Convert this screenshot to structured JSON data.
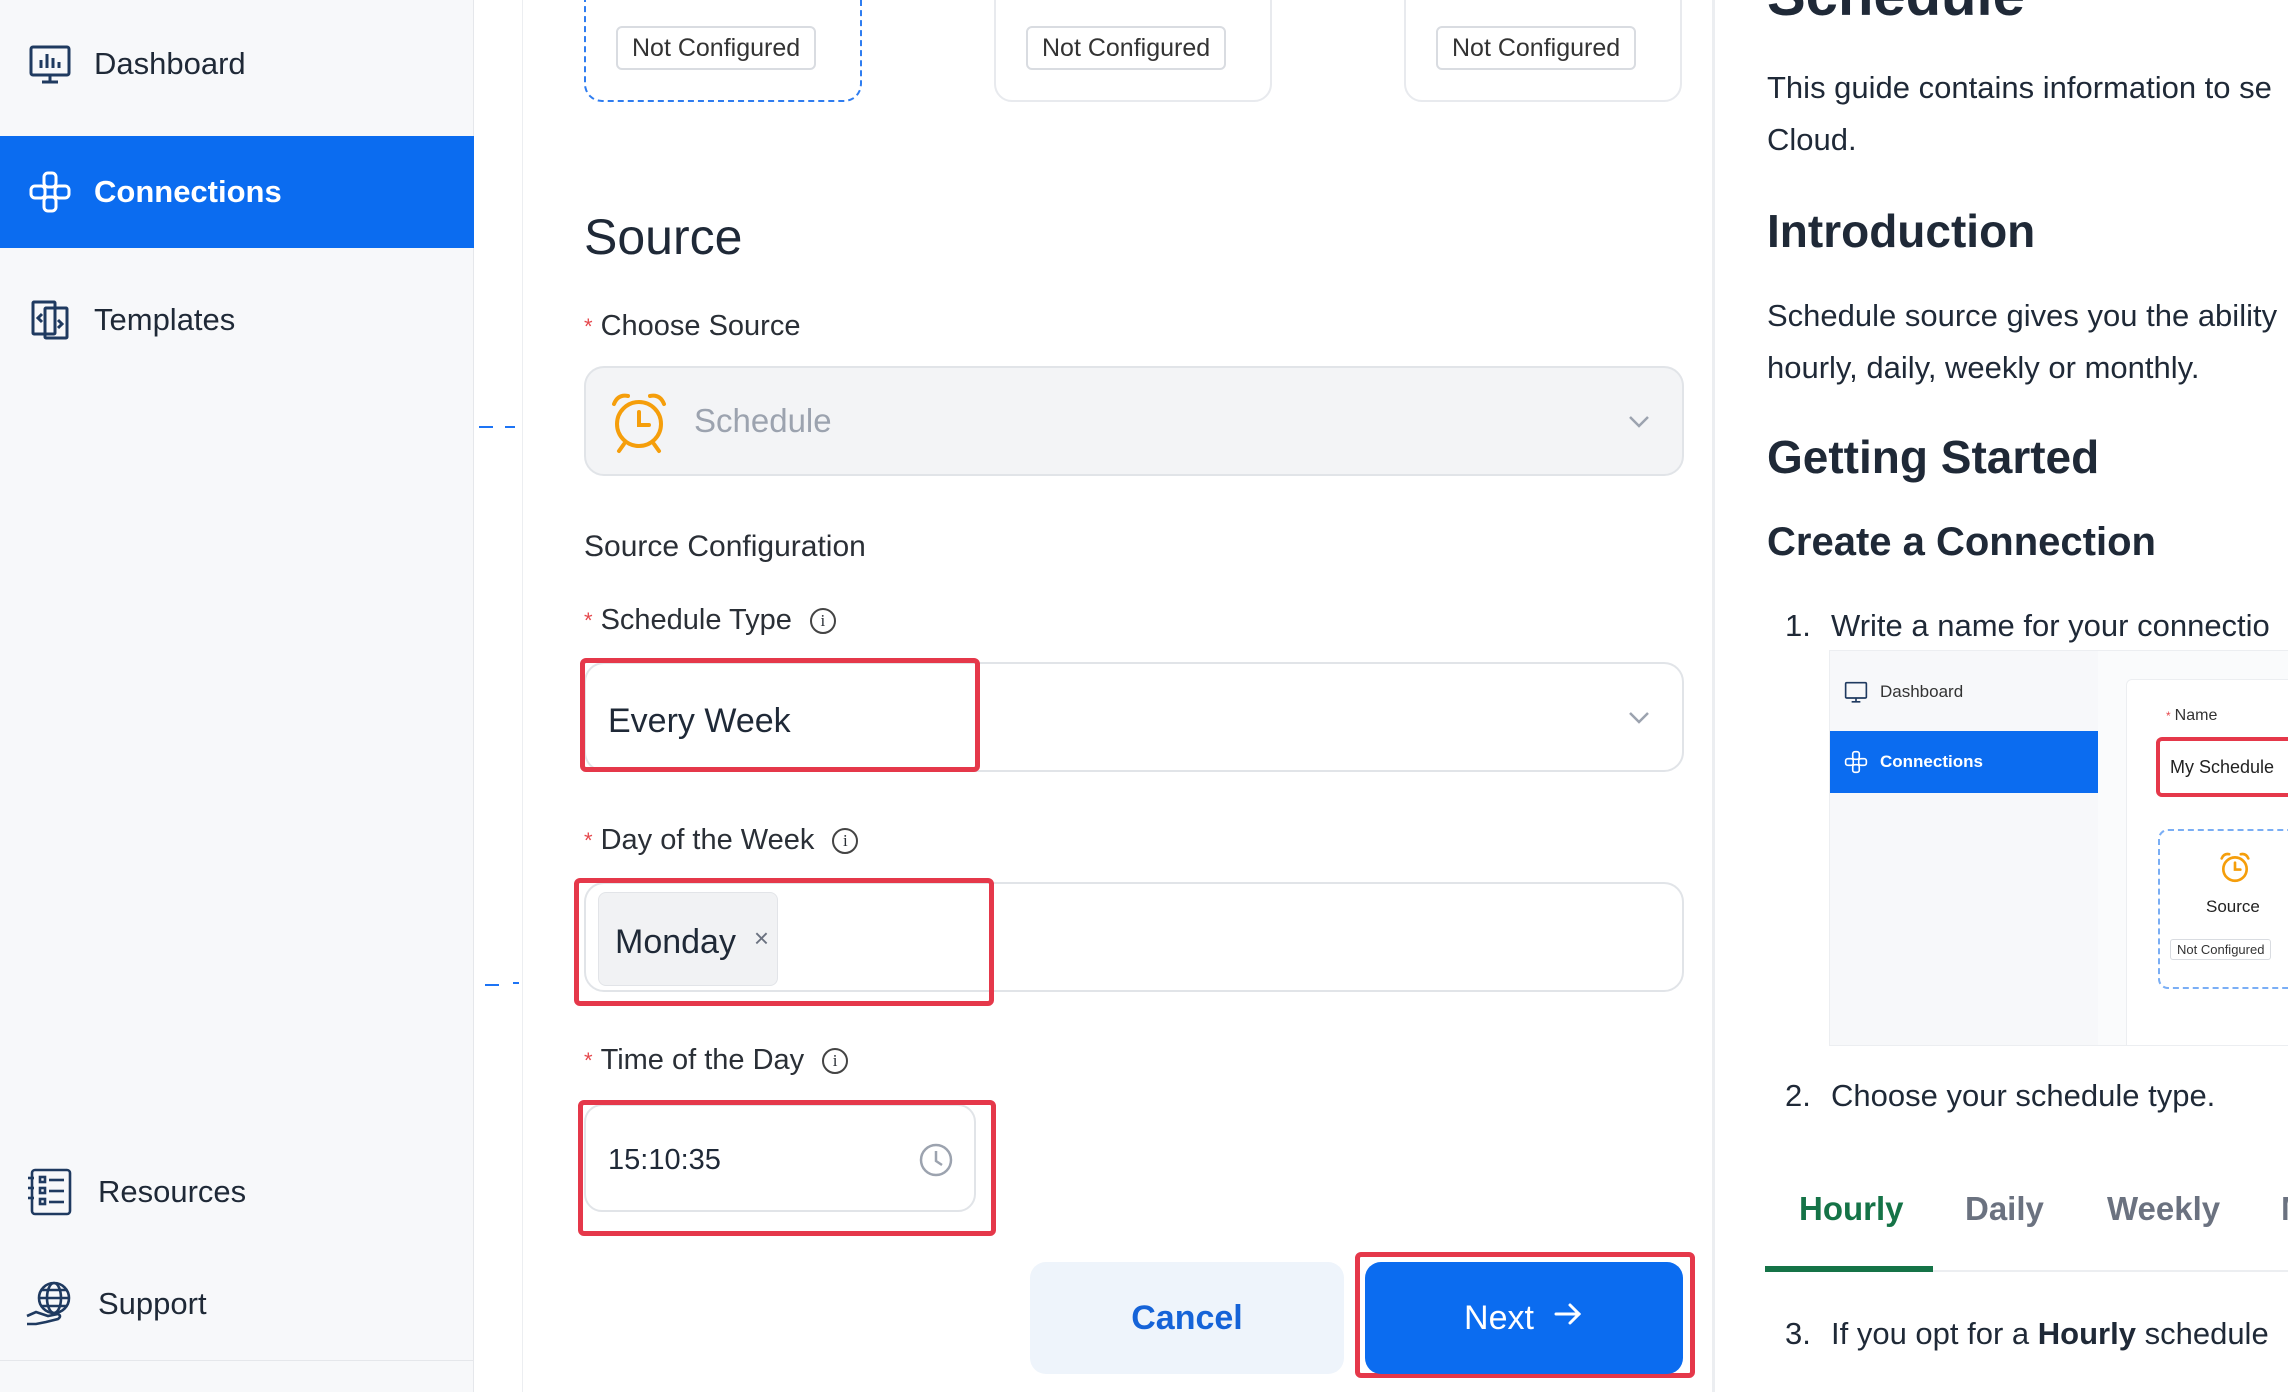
{
  "sidebar": {
    "items": [
      {
        "label": "Dashboard",
        "icon": "dashboard-icon"
      },
      {
        "label": "Connections",
        "icon": "connections-icon",
        "active": true
      },
      {
        "label": "Templates",
        "icon": "templates-icon"
      }
    ],
    "bottom_items": [
      {
        "label": "Resources",
        "icon": "resources-icon"
      },
      {
        "label": "Support",
        "icon": "support-icon"
      }
    ]
  },
  "steps": [
    {
      "status": "Not Configured"
    },
    {
      "status": "Not Configured"
    },
    {
      "status": "Not Configured"
    }
  ],
  "form": {
    "section_title": "Source",
    "choose_source_label": "Choose Source",
    "source_value": "Schedule",
    "source_config_title": "Source Configuration",
    "schedule_type_label": "Schedule Type",
    "schedule_type_value": "Every Week",
    "day_of_week_label": "Day of the Week",
    "day_of_week_tag": "Monday",
    "time_of_day_label": "Time of the Day",
    "time_of_day_value": "15:10:35",
    "cancel_label": "Cancel",
    "next_label": "Next"
  },
  "guide": {
    "top_heading_partial": "Schedule",
    "intro_text_line1": "This guide contains information to se",
    "intro_text_line2": "Cloud.",
    "introduction_heading": "Introduction",
    "introduction_line1": "Schedule source gives you the ability",
    "introduction_line2": "hourly, daily, weekly or monthly.",
    "getting_started_heading": "Getting Started",
    "create_connection_heading": "Create a Connection",
    "step1_num": "1.",
    "step1_text": "Write a name for your connectio",
    "step2_num": "2.",
    "step2_text": "Choose your schedule type.",
    "step3_num": "3.",
    "step3_text_pre": "If you opt for a ",
    "step3_text_bold": "Hourly",
    "step3_text_post": " schedule",
    "mini": {
      "dashboard_label": "Dashboard",
      "connections_label": "Connections",
      "name_label": "Name",
      "name_value": "My Schedule",
      "source_label": "Source",
      "source_status": "Not Configured"
    },
    "tabs": [
      "Hourly",
      "Daily",
      "Weekly",
      "M"
    ],
    "active_tab": "Hourly"
  },
  "colors": {
    "primary": "#0b6cf0",
    "highlight": "#e5384a",
    "tab_active": "#157347",
    "schedule_icon": "#f59e0b"
  }
}
